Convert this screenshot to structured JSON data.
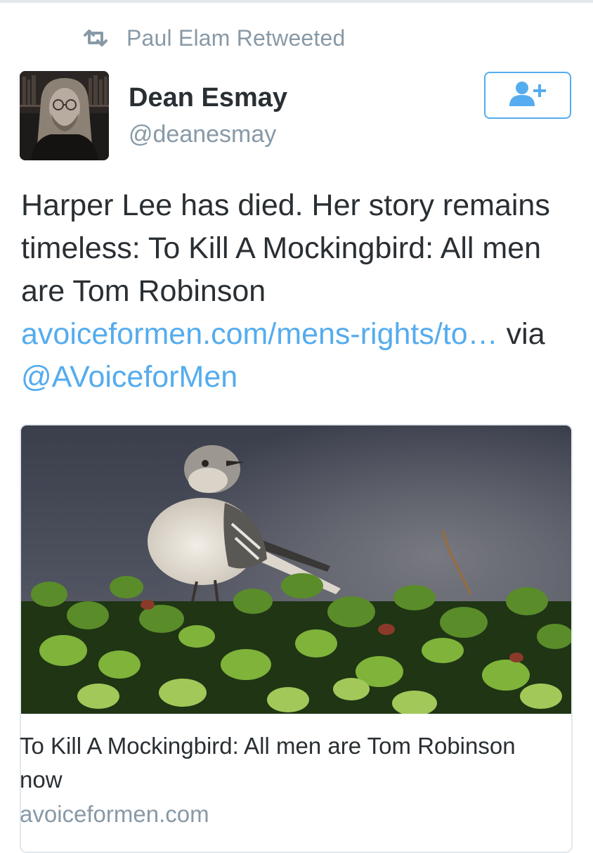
{
  "retweet": {
    "icon": "retweet-icon",
    "text": "Paul Elam Retweeted"
  },
  "author": {
    "name": "Dean Esmay",
    "handle": "@deanesmay",
    "avatar_icon": "avatar"
  },
  "follow_button": {
    "icon": "follow-user-icon"
  },
  "tweet": {
    "text_main": "Harper Lee has died. Her story remains timeless: To Kill A Mockingbird: All men are Tom Robinson",
    "link_text": "avoiceformen.com/mens-rights/to…",
    "via_text": "via",
    "mention": "@AVoiceforMen"
  },
  "card": {
    "title": "To Kill A Mockingbird: All men are Tom Robinson now",
    "domain": "avoiceformen.com"
  },
  "colors": {
    "link": "#55acee",
    "muted": "#8899a6",
    "text": "#292f33",
    "border": "#e1e8ed"
  }
}
